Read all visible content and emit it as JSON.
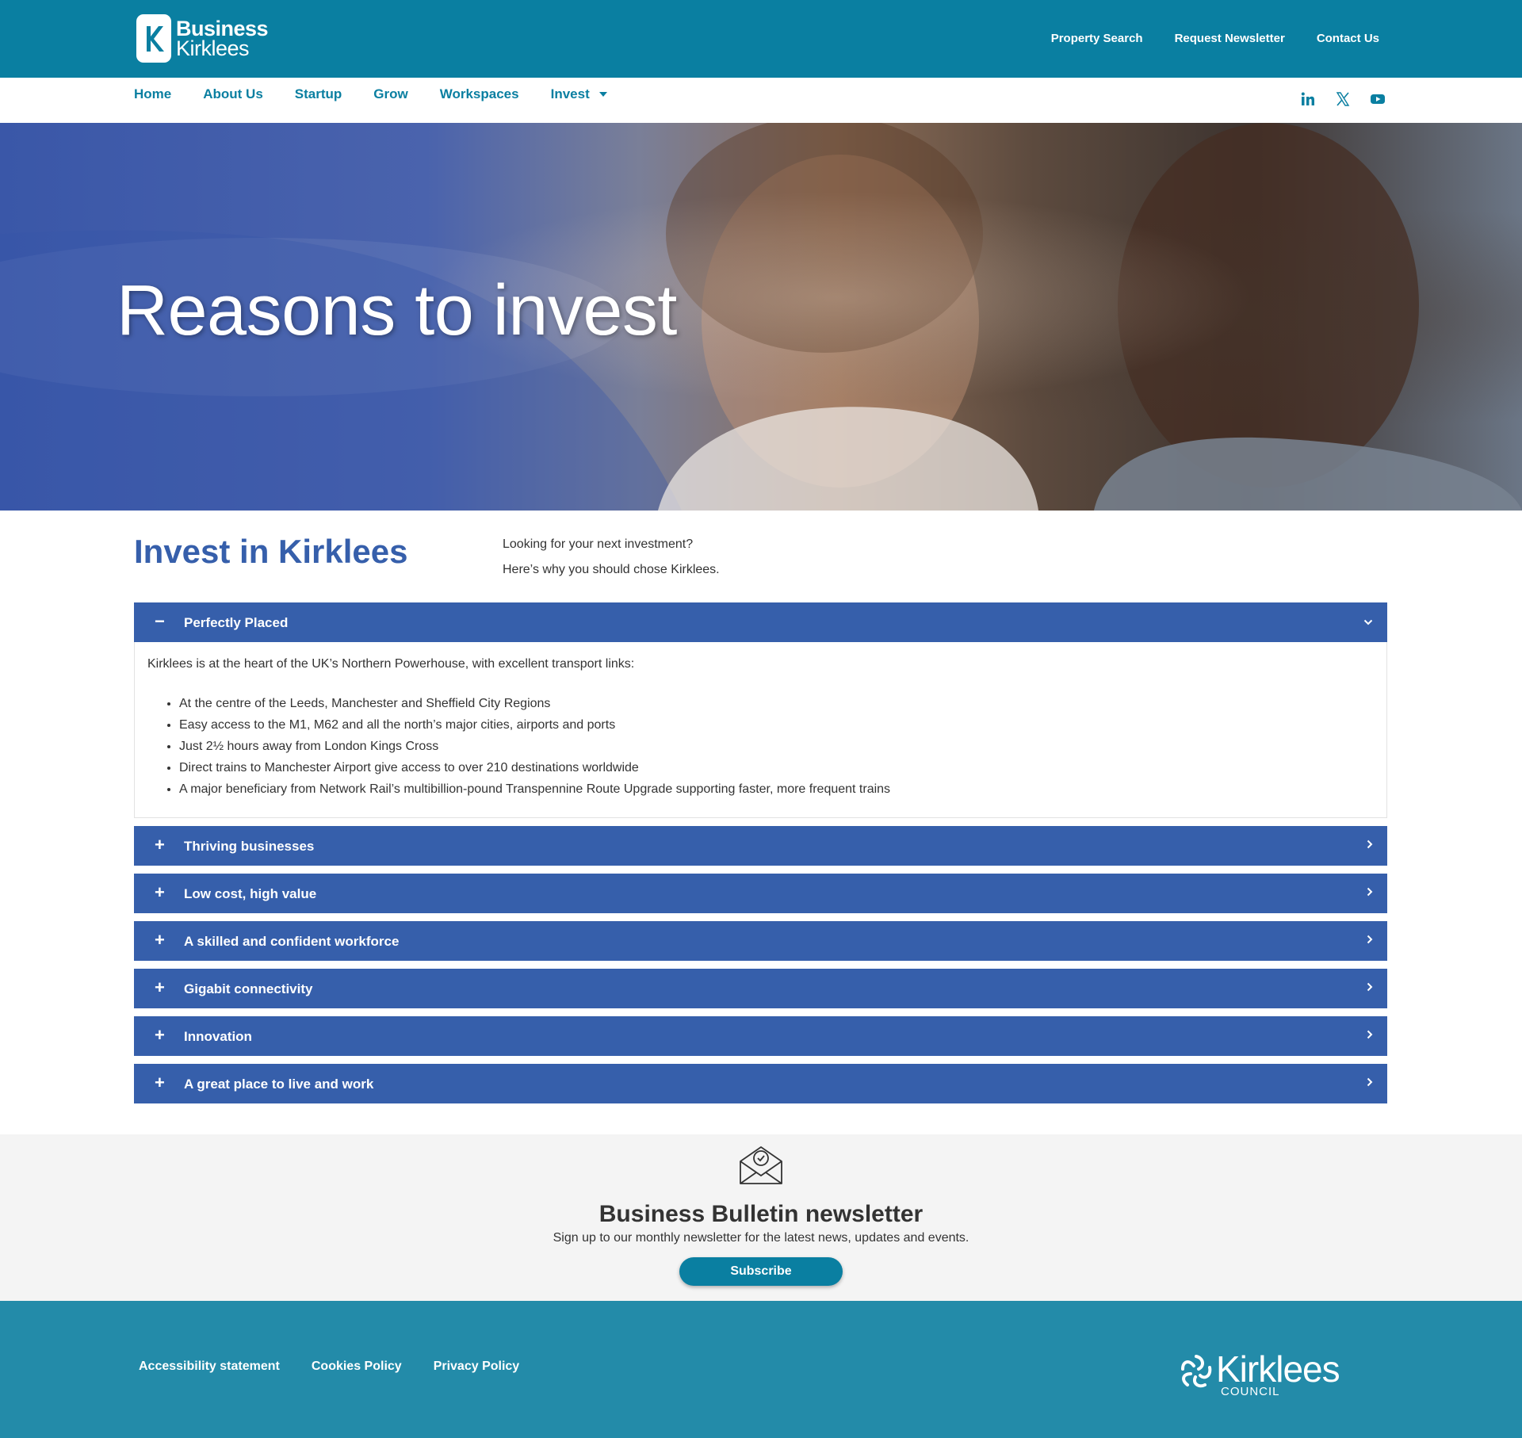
{
  "header": {
    "logo_line1": "Business",
    "logo_line2": "Kirklees",
    "utility_links": [
      "Property Search",
      "Request Newsletter",
      "Contact Us"
    ]
  },
  "nav": {
    "items": [
      "Home",
      "About Us",
      "Startup",
      "Grow",
      "Workspaces",
      "Invest"
    ],
    "social_icons": [
      "linkedin-icon",
      "x-icon",
      "youtube-icon"
    ]
  },
  "hero": {
    "title": "Reasons to invest"
  },
  "intro": {
    "title": "Invest in Kirklees",
    "line1": "Looking for your next investment?",
    "line2": "Here’s why you should chose Kirklees."
  },
  "accordion": {
    "open_section": {
      "title": "Perfectly Placed",
      "intro": "Kirklees is at the heart of the UK’s Northern Powerhouse, with excellent transport links:",
      "bullets": [
        "At the centre of the Leeds, Manchester and Sheffield City Regions",
        "Easy access to the M1, M62 and all the north’s major cities, airports and ports",
        "Just 2½ hours away from London Kings Cross",
        "Direct trains to Manchester Airport give access to over 210 destinations worldwide",
        "A major beneficiary from Network Rail’s multibillion-pound Transpennine Route Upgrade supporting faster, more frequent trains"
      ]
    },
    "closed_sections": [
      "Thriving businesses",
      "Low cost, high value",
      "A skilled and confident workforce",
      "Gigabit connectivity",
      "Innovation",
      "A great place to live and work"
    ]
  },
  "newsletter": {
    "title": "Business Bulletin newsletter",
    "subtitle": "Sign up to our monthly newsletter for the latest news, updates and events.",
    "button": "Subscribe"
  },
  "footer": {
    "links": [
      "Accessibility statement",
      "Cookies Policy",
      "Privacy Policy"
    ],
    "logo_word": "Kirklees",
    "logo_sub": "COUNCIL"
  },
  "colors": {
    "header_teal": "#0a7fa1",
    "accordion_blue": "#365fab",
    "footer_teal": "#238ba9"
  }
}
